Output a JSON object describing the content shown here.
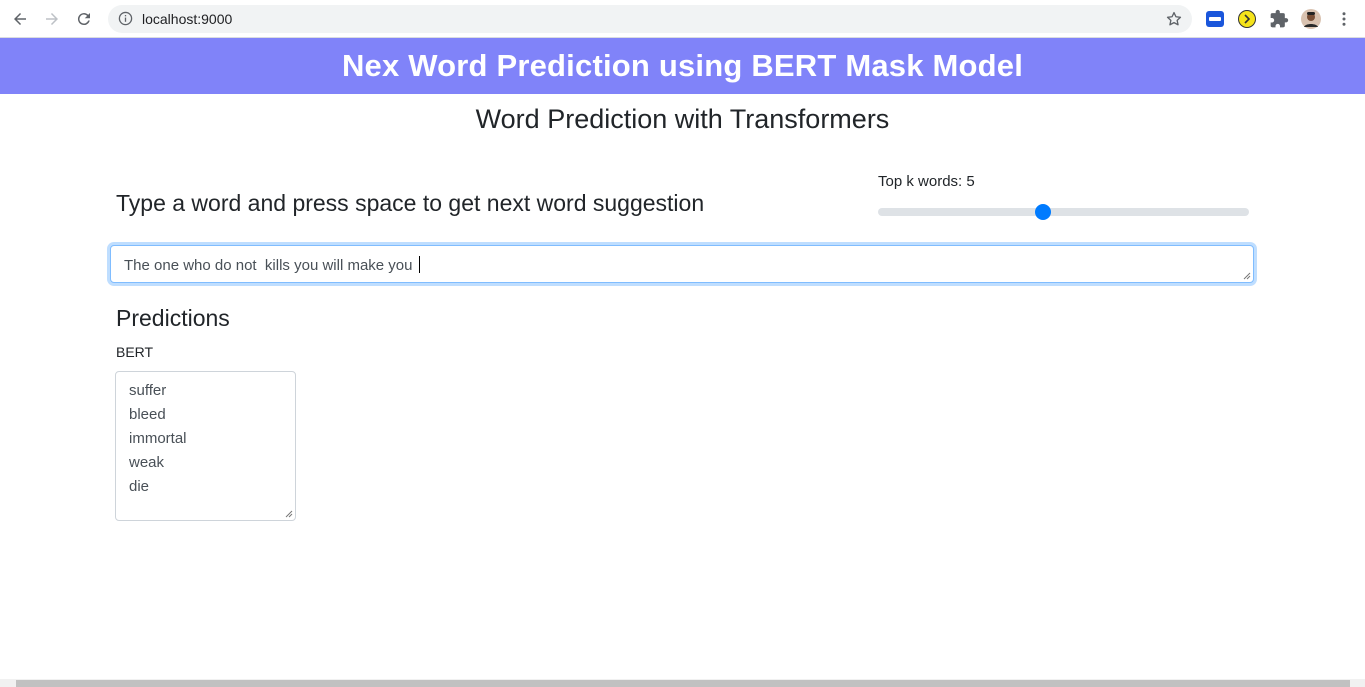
{
  "browser": {
    "url": "localhost:9000"
  },
  "header": {
    "title": "Nex Word Prediction using BERT Mask Model"
  },
  "main": {
    "subtitle": "Word Prediction with Transformers",
    "instruction": "Type a word and press space to get next word suggestion",
    "topk": {
      "label": "Top k words: 5",
      "value": 5,
      "fraction": 0.44
    },
    "input_value": "The one who do not  kills you will make you ",
    "predictions_title": "Predictions",
    "model_label": "BERT",
    "predictions": [
      "suffer",
      "bleed",
      "immortal",
      "weak",
      "die"
    ]
  },
  "colors": {
    "banner": "#8083f9",
    "accent": "#007bff"
  }
}
